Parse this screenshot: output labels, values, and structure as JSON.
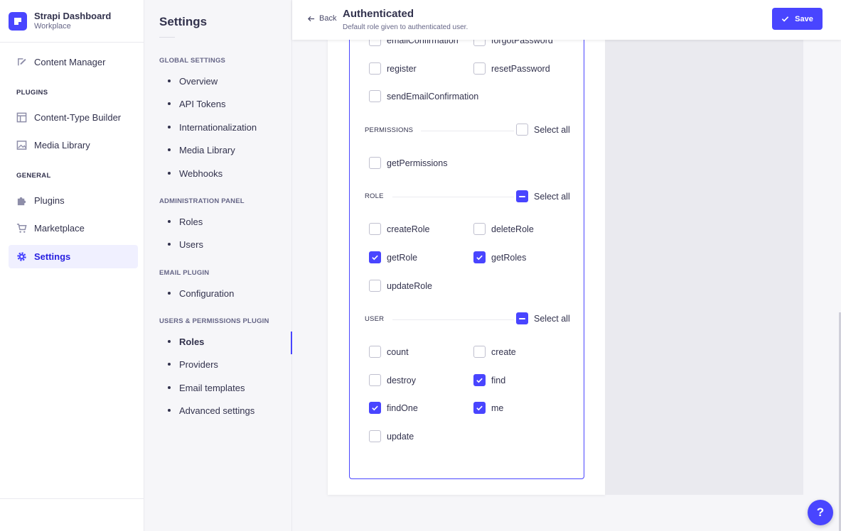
{
  "app": {
    "title": "Strapi Dashboard",
    "workspace": "Workplace"
  },
  "mainnav": {
    "content_manager": "Content Manager",
    "plugins_title": "PLUGINS",
    "content_type_builder": "Content-Type Builder",
    "media_library": "Media Library",
    "general_title": "GENERAL",
    "plugins": "Plugins",
    "marketplace": "Marketplace",
    "settings": "Settings"
  },
  "subnav": {
    "title": "Settings",
    "global_title": "GLOBAL SETTINGS",
    "global_items": [
      "Overview",
      "API Tokens",
      "Internationalization",
      "Media Library",
      "Webhooks"
    ],
    "admin_title": "ADMINISTRATION PANEL",
    "admin_items": [
      "Roles",
      "Users"
    ],
    "email_title": "EMAIL PLUGIN",
    "email_items": [
      "Configuration"
    ],
    "up_title": "USERS & PERMISSIONS PLUGIN",
    "up_items": [
      "Roles",
      "Providers",
      "Email templates",
      "Advanced settings"
    ]
  },
  "header": {
    "back": "Back",
    "title": "Authenticated",
    "subtitle": "Default role given to authenticated user.",
    "save": "Save"
  },
  "permissions": {
    "auth_partial": [
      {
        "label": "emailConfirmation",
        "checked": false
      },
      {
        "label": "forgotPassword",
        "checked": false
      },
      {
        "label": "register",
        "checked": false
      },
      {
        "label": "resetPassword",
        "checked": false
      },
      {
        "label": "sendEmailConfirmation",
        "checked": false
      }
    ],
    "permissions_group": {
      "label": "PERMISSIONS",
      "select_all": "Select all",
      "select_all_state": "unchecked",
      "actions": [
        {
          "label": "getPermissions",
          "checked": false
        }
      ]
    },
    "role_group": {
      "label": "ROLE",
      "select_all": "Select all",
      "select_all_state": "indeterminate",
      "actions": [
        {
          "label": "createRole",
          "checked": false
        },
        {
          "label": "deleteRole",
          "checked": false
        },
        {
          "label": "getRole",
          "checked": true
        },
        {
          "label": "getRoles",
          "checked": true
        },
        {
          "label": "updateRole",
          "checked": false
        }
      ]
    },
    "user_group": {
      "label": "USER",
      "select_all": "Select all",
      "select_all_state": "indeterminate",
      "actions": [
        {
          "label": "count",
          "checked": false
        },
        {
          "label": "create",
          "checked": false
        },
        {
          "label": "destroy",
          "checked": false
        },
        {
          "label": "find",
          "checked": true
        },
        {
          "label": "findOne",
          "checked": true
        },
        {
          "label": "me",
          "checked": true
        },
        {
          "label": "update",
          "checked": false
        }
      ]
    }
  },
  "help": {
    "label": "?"
  },
  "colors": {
    "accent": "#4945ff",
    "text": "#32324d",
    "muted": "#666687"
  }
}
